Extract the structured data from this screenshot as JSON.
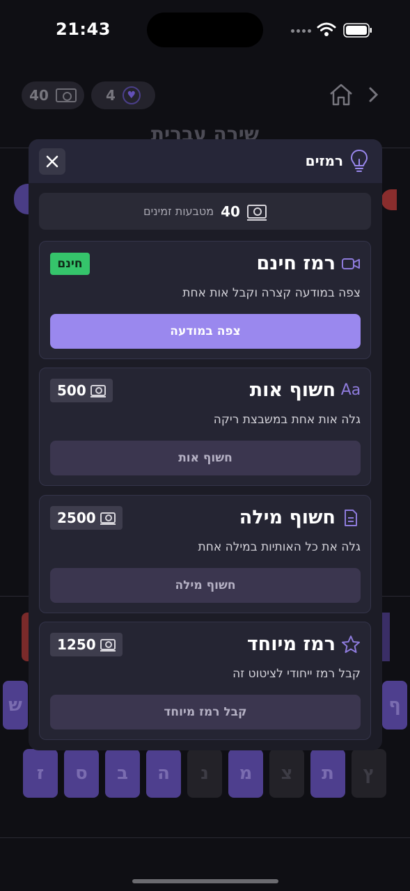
{
  "status_bar": {
    "time": "21:43"
  },
  "top_bar": {
    "coins": "40",
    "lives": "4"
  },
  "game": {
    "title": "שירה עברית",
    "keyboard_row2": [
      "ז",
      "ס",
      "ב",
      "ה",
      "נ",
      "מ",
      "צ",
      "ת",
      "ץ"
    ],
    "keyboard_side_left": "ש",
    "keyboard_side_right": "ף"
  },
  "modal": {
    "title": "רמזים",
    "coin_banner": {
      "amount": "40",
      "label": "מטבעות זמינים"
    },
    "hints": [
      {
        "title": "רמז חינם",
        "icon": "video-icon",
        "badge": "חינם",
        "description": "צפה במודעה קצרה וקבל אות אחת",
        "button": "צפה במודעה"
      },
      {
        "title": "חשוף אות",
        "icon": "letters-icon",
        "icon_text": "Aa",
        "cost": "500",
        "description": "גלה אות אחת במשבצת ריקה",
        "button": "חשוף אות"
      },
      {
        "title": "חשוף מילה",
        "icon": "document-icon",
        "cost": "2500",
        "description": "גלה את כל האותיות במילה אחת",
        "button": "חשוף מילה"
      },
      {
        "title": "רמז מיוחד",
        "icon": "star-icon",
        "cost": "1250",
        "description": "קבל רמז ייחודי לציטוט זה",
        "button": "קבל רמז מיוחד"
      }
    ]
  },
  "colors": {
    "accent": "#9a88ee",
    "free_badge": "#35c46b",
    "modal_bg": "#1c1c26",
    "card_bg": "#252533"
  }
}
